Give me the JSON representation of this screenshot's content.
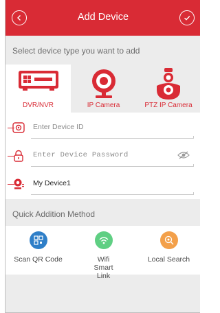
{
  "header": {
    "title": "Add Device",
    "back_icon": "chevron-left-icon",
    "confirm_icon": "check-icon"
  },
  "select_label": "Select device type you want to add",
  "device_types": [
    {
      "label": "DVR/NVR",
      "icon": "dvr-recorder-icon",
      "selected": true
    },
    {
      "label": "IP Camera",
      "icon": "ip-camera-icon",
      "selected": false
    },
    {
      "label": "PTZ IP Camera",
      "icon": "ptz-camera-icon",
      "selected": false
    }
  ],
  "form": {
    "device_id_placeholder": "Enter Device ID",
    "password_placeholder": "Enter Device Password",
    "device_name_value": "My Device1"
  },
  "quick_label": "Quick Addition Method",
  "quick_methods": [
    {
      "label": "Scan QR Code",
      "icon": "qr-code-icon",
      "color": "#2f7fc8"
    },
    {
      "label": "Wifi Smart Link",
      "icon": "wifi-icon",
      "color": "#5fcf83"
    },
    {
      "label": "Local Search",
      "icon": "local-search-icon",
      "color": "#f3a04a"
    }
  ],
  "colors": {
    "accent": "#d92b35",
    "background": "#ececec"
  }
}
